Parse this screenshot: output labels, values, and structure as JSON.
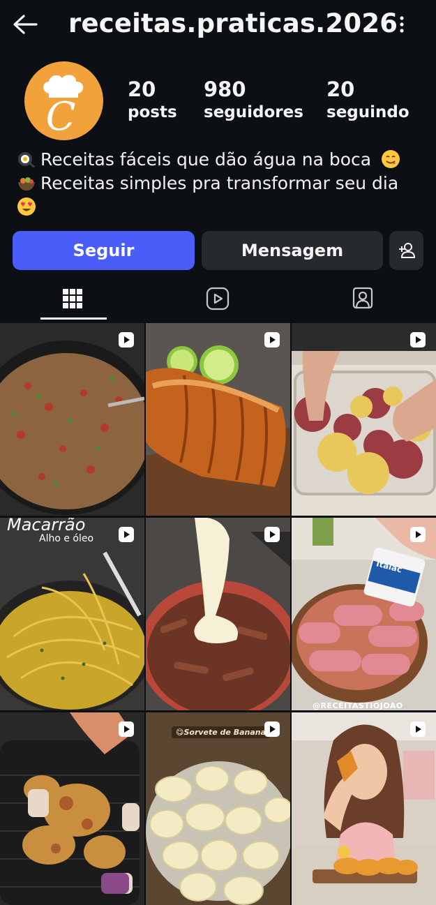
{
  "header": {
    "username": "receitas.praticas.2026"
  },
  "profile": {
    "avatar_letter": "C",
    "stats": [
      {
        "value": "20",
        "label": "posts"
      },
      {
        "value": "980",
        "label": "seguidores"
      },
      {
        "value": "20",
        "label": "seguindo"
      }
    ],
    "bio_lines": [
      "Receitas fáceis que dão água na boca",
      "Receitas simples pra transformar seu dia"
    ]
  },
  "actions": {
    "follow": "Seguir",
    "message": "Mensagem"
  },
  "tabs": [
    "posts-grid-icon",
    "reels-icon",
    "tagged-icon"
  ],
  "posts": [
    {
      "id": 1,
      "type": "reel",
      "caption": ""
    },
    {
      "id": 2,
      "type": "reel",
      "caption": ""
    },
    {
      "id": 3,
      "type": "reel",
      "caption": ""
    },
    {
      "id": 4,
      "type": "reel",
      "caption": "Macarrão",
      "subcaption": "Alho e óleo"
    },
    {
      "id": 5,
      "type": "reel",
      "caption": ""
    },
    {
      "id": 6,
      "type": "reel",
      "caption": "@RECEITASTIOJOAO",
      "box_label": "Italac"
    },
    {
      "id": 7,
      "type": "reel",
      "caption": ""
    },
    {
      "id": 8,
      "type": "reel",
      "caption": "😋Sorvete de Banana"
    },
    {
      "id": 9,
      "type": "reel",
      "caption": ""
    }
  ],
  "colors": {
    "follow_button": "#4a5df9",
    "avatar_bg": "#f1a23a",
    "background": "#0c1014"
  }
}
